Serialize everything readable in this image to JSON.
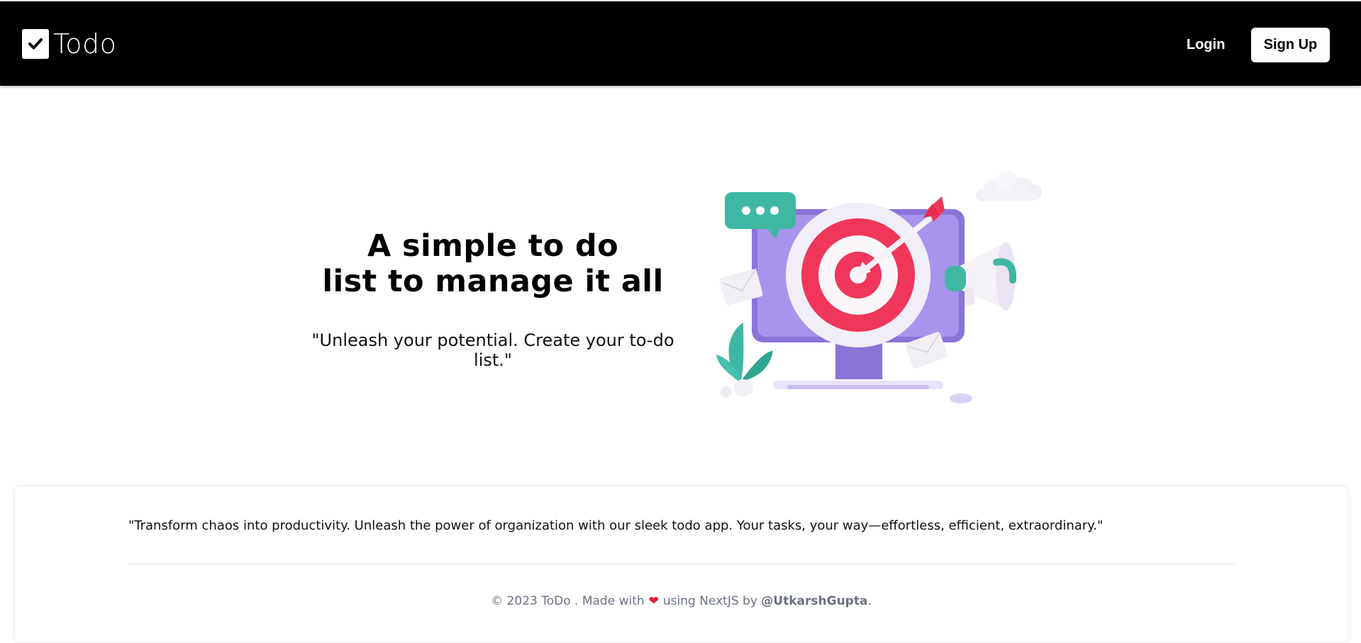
{
  "header": {
    "brand_title": "Todo",
    "login_label": "Login",
    "signup_label": "Sign Up"
  },
  "hero": {
    "title_line1": "A simple to do",
    "title_line2": "list to manage it all",
    "subtitle": "\"Unleash your potential. Create your to-do list.\""
  },
  "footer": {
    "quote": "\"Transform chaos into productivity. Unleash the power of organization with our sleek todo app. Your tasks, your way—effortless, efficient, extraordinary.\"",
    "copyright": "© 2023 ToDo . Made with",
    "heart": "❤",
    "built_with": "using NextJS by",
    "author": "@UtkarshGupta",
    "period": "."
  },
  "colors": {
    "header_bg": "#000000",
    "target_red": "#f0365a",
    "monitor_purple": "#9b86e6",
    "accent_teal": "#3fb8a3"
  },
  "icons": {
    "brand": "checkbox-check-icon",
    "illustration": "target-monitor-illustration"
  }
}
